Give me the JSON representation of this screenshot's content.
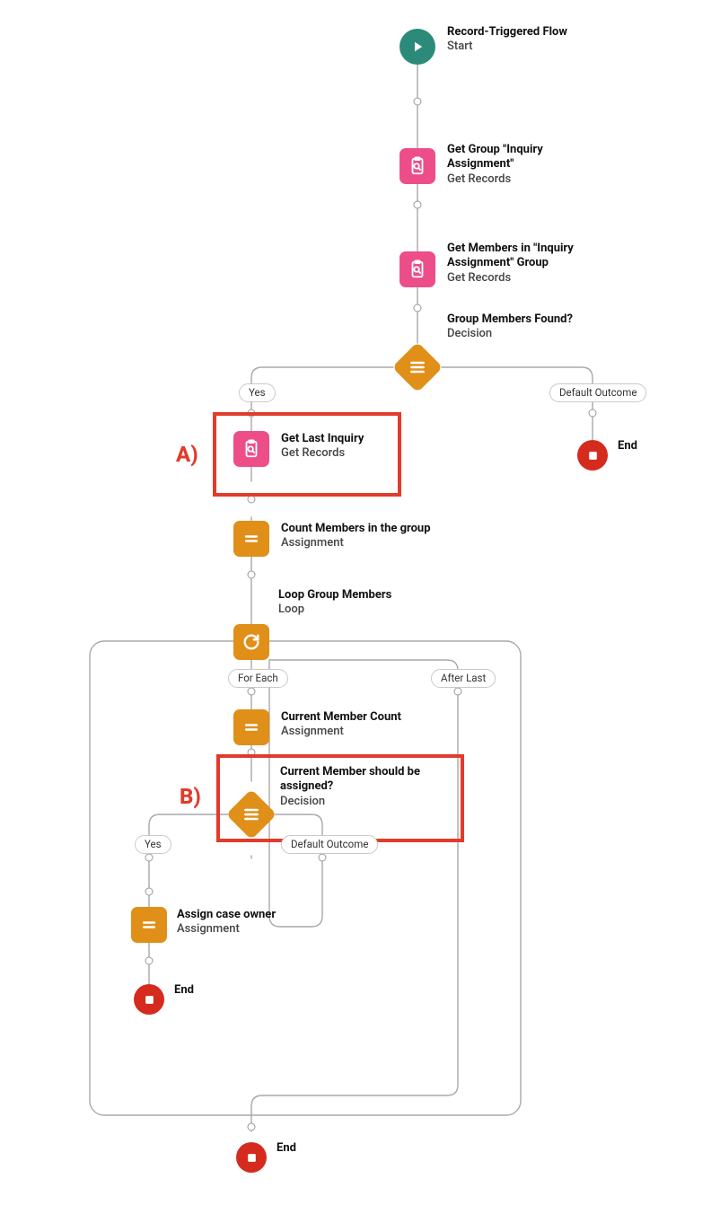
{
  "nodes": {
    "start": {
      "title": "Record-Triggered Flow",
      "sub": "Start"
    },
    "getGroup": {
      "title": "Get Group \"Inquiry Assignment\"",
      "sub": "Get Records"
    },
    "getMembers": {
      "title": "Get Members in \"Inquiry Assignment\" Group",
      "sub": "Get Records"
    },
    "membersFound": {
      "title": "Group Members Found?",
      "sub": "Decision"
    },
    "getLast": {
      "title": "Get Last Inquiry",
      "sub": "Get Records"
    },
    "countMembers": {
      "title": "Count Members in the group",
      "sub": "Assignment"
    },
    "loop": {
      "title": "Loop Group Members",
      "sub": "Loop"
    },
    "currentCount": {
      "title": "Current Member Count",
      "sub": "Assignment"
    },
    "shouldAssign": {
      "title": "Current Member should be assigned?",
      "sub": "Decision"
    },
    "assignOwner": {
      "title": "Assign case owner",
      "sub": "Assignment"
    },
    "end1": {
      "title": "End"
    },
    "end2": {
      "title": "End"
    },
    "end3": {
      "title": "End"
    }
  },
  "pills": {
    "yes1": "Yes",
    "defaultOutcome1": "Default Outcome",
    "forEach": "For Each",
    "afterLast": "After Last",
    "yes2": "Yes",
    "defaultOutcome2": "Default Outcome"
  },
  "annotations": {
    "a": "A)",
    "b": "B)"
  }
}
